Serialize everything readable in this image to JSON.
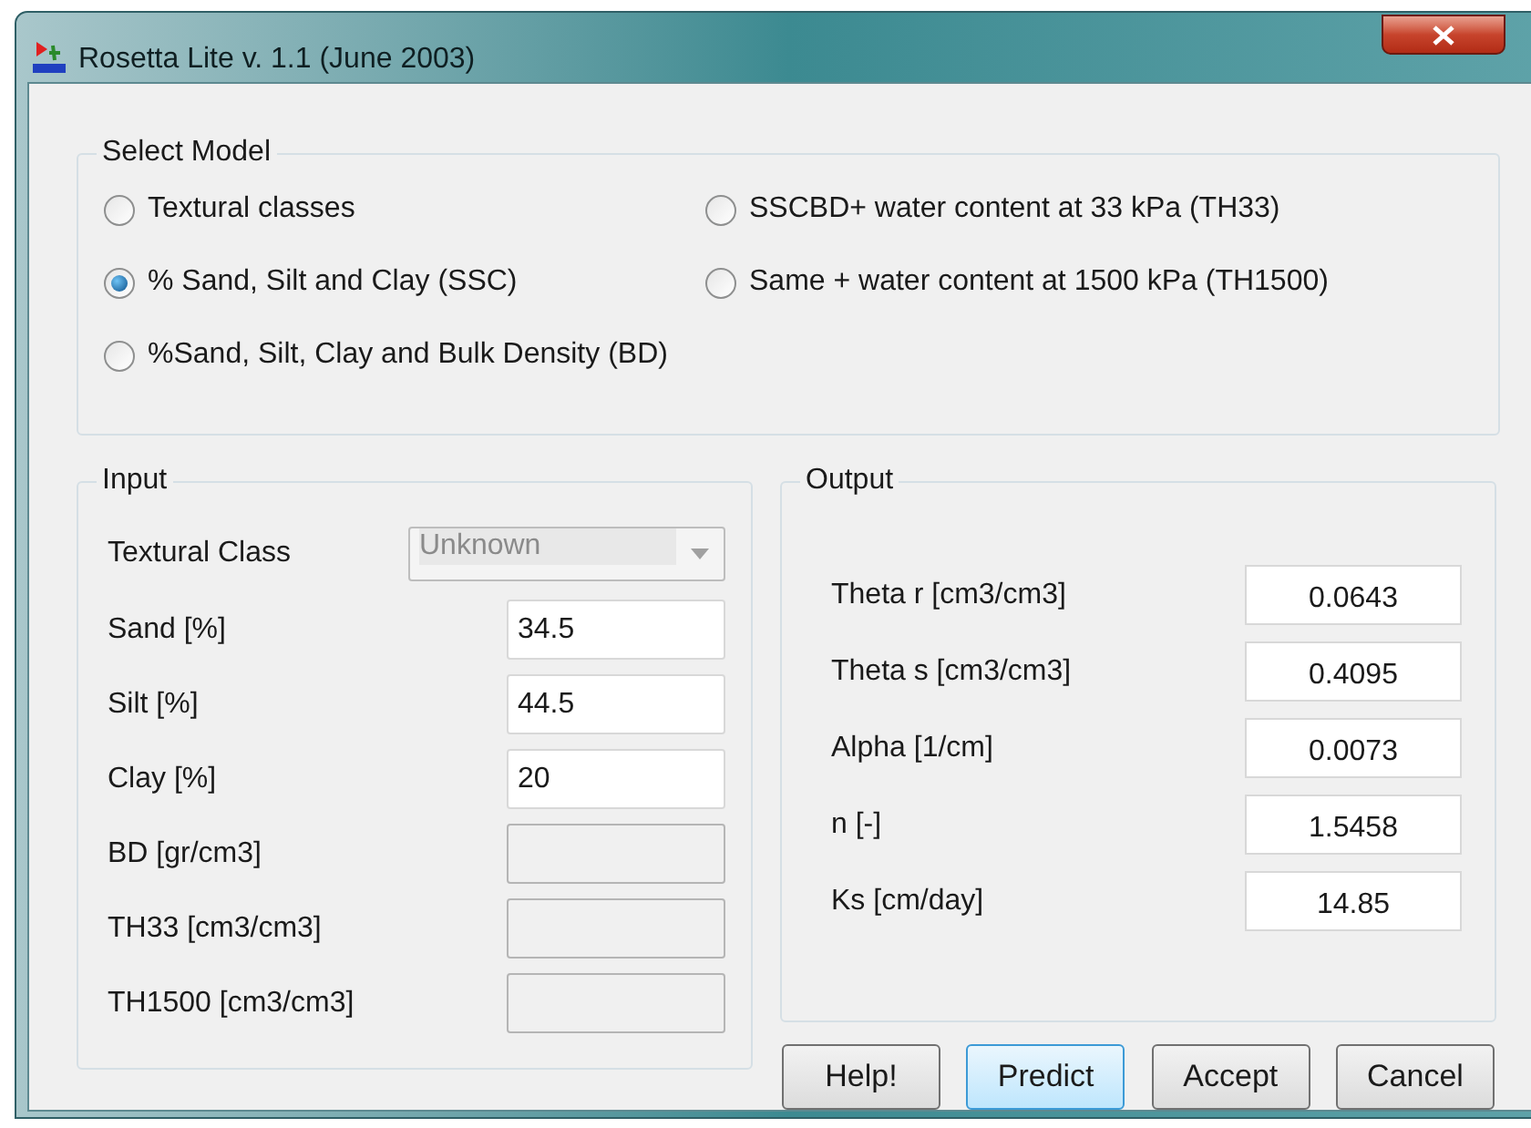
{
  "window": {
    "title": "Rosetta Lite v. 1.1 (June 2003)"
  },
  "select_model": {
    "title": "Select Model",
    "options": [
      {
        "label": "Textural classes",
        "selected": false
      },
      {
        "label": "% Sand, Silt and Clay (SSC)",
        "selected": true
      },
      {
        "label": "%Sand, Silt, Clay and Bulk Density (BD)",
        "selected": false
      },
      {
        "label": "SSCBD+ water content at 33 kPa (TH33)",
        "selected": false
      },
      {
        "label": "Same + water content at 1500 kPa (TH1500)",
        "selected": false
      }
    ]
  },
  "input": {
    "title": "Input",
    "textural_class": {
      "label": "Textural Class",
      "value": "Unknown",
      "disabled": true
    },
    "fields": [
      {
        "label": "Sand [%]",
        "value": "34.5",
        "disabled": false
      },
      {
        "label": "Silt [%]",
        "value": "44.5",
        "disabled": false
      },
      {
        "label": "Clay [%]",
        "value": "20",
        "disabled": false
      },
      {
        "label": "BD [gr/cm3]",
        "disabled": true
      },
      {
        "label": "TH33 [cm3/cm3]",
        "disabled": true
      },
      {
        "label": "TH1500 [cm3/cm3]",
        "disabled": true
      }
    ]
  },
  "output": {
    "title": "Output",
    "fields": [
      {
        "label": "Theta r [cm3/cm3]",
        "value": "0.0643"
      },
      {
        "label": "Theta s [cm3/cm3]",
        "value": "0.4095"
      },
      {
        "label": "Alpha [1/cm]",
        "value": "0.0073"
      },
      {
        "label": "n [-]",
        "value": "1.5458"
      },
      {
        "label": "Ks [cm/day]",
        "value": "14.85"
      }
    ]
  },
  "buttons": [
    {
      "label": "Help!",
      "default": false
    },
    {
      "label": "Predict",
      "default": true
    },
    {
      "label": "Accept",
      "default": false
    },
    {
      "label": "Cancel",
      "default": false
    }
  ]
}
